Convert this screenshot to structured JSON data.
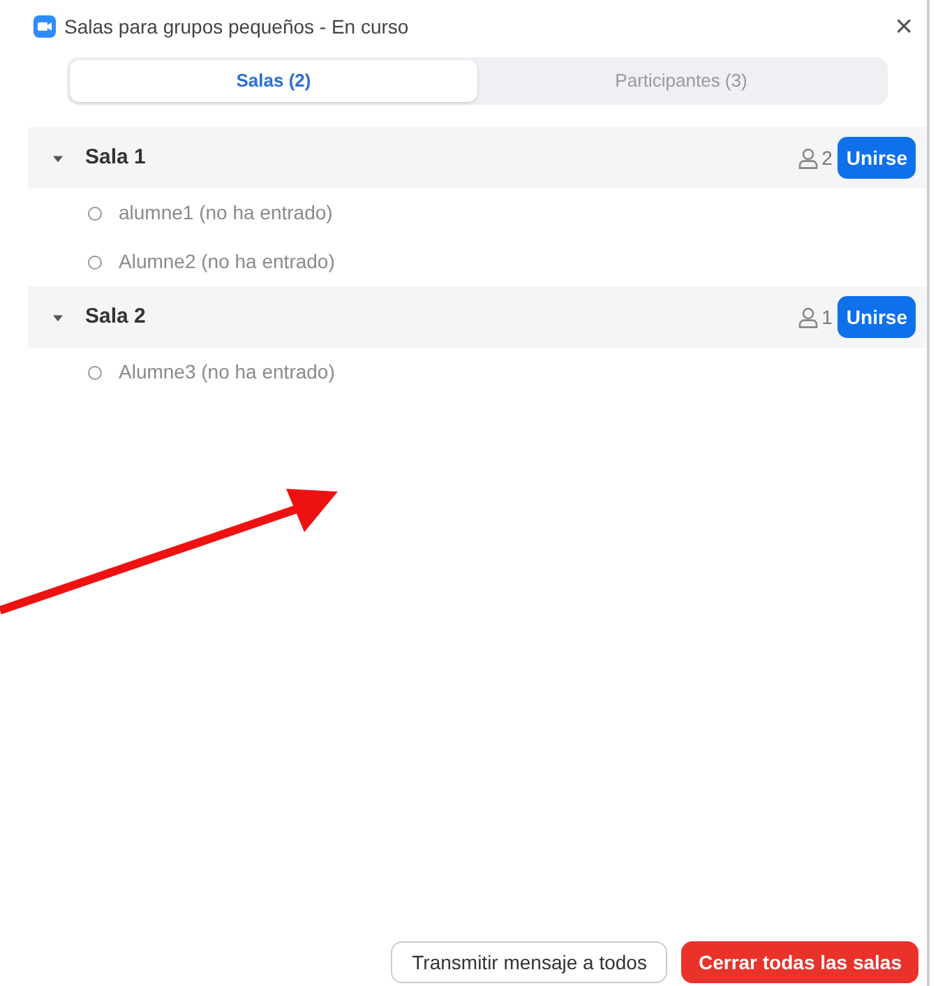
{
  "window": {
    "title": "Salas para grupos pequeños - En curso",
    "close": "×"
  },
  "tabs": [
    {
      "label": "Salas (2)",
      "selected": true
    },
    {
      "label": "Participantes (3)",
      "selected": false
    }
  ],
  "rooms": [
    {
      "name": "Sala 1",
      "expanded": true,
      "count": "2",
      "join": "Unirse",
      "participants": [
        "alumne1 (no ha entrado)",
        "Alumne2 (no ha entrado)"
      ]
    },
    {
      "name": "Sala 2",
      "expanded": true,
      "count": "1",
      "join": "Unirse",
      "participants": [
        "Alumne3 (no ha entrado)"
      ]
    }
  ],
  "footer": {
    "broadcast": "Transmitir mensaje a todos",
    "close_all": "Cerrar todas las salas"
  }
}
